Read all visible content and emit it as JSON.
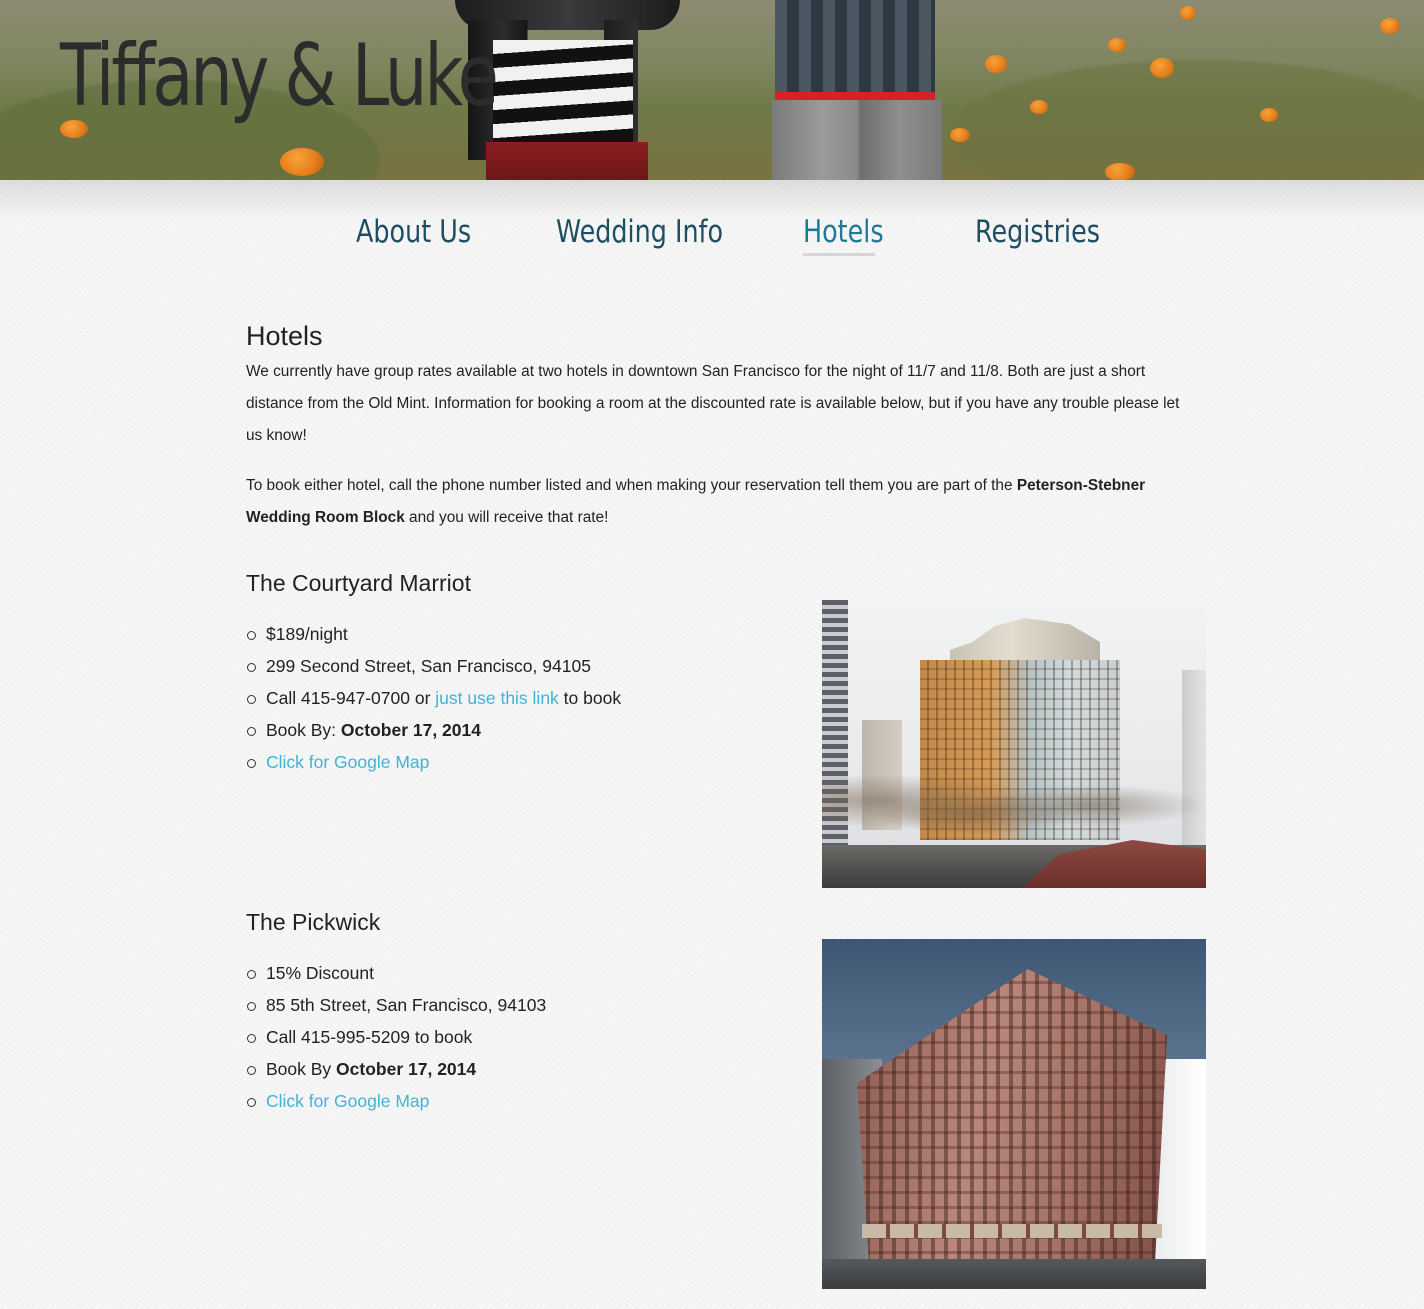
{
  "header": {
    "site_title": "Tiffany & Luke"
  },
  "nav": {
    "items": [
      {
        "label": "About Us"
      },
      {
        "label": "Wedding Info"
      },
      {
        "label": "Hotels"
      },
      {
        "label": "Registries"
      }
    ],
    "active": "Hotels"
  },
  "main": {
    "title": "Hotels",
    "intro": "We currently have group rates available at two hotels in downtown San Francisco for the night of 11/7 and 11/8. Both are just a short distance from the Old Mint. Information for booking a room at the discounted rate is available below, but if you have any trouble please let us know!",
    "booking_prefix": "To book either hotel, call the phone number listed and when making your reservation tell them you are part of the ",
    "booking_bold": "Peterson-Stebner Wedding Room Block",
    "booking_suffix": " and you will receive that rate!"
  },
  "hotels": [
    {
      "name": "The Courtyard Marriot",
      "rate": "$189/night",
      "address": "299 Second Street, San Francisco, 94105",
      "call_prefix": "Call 415-947-0700 or ",
      "call_link": "just use this link",
      "call_suffix": " to book",
      "book_by_label": "Book By: ",
      "book_by_date": "October 17, 2014",
      "map_link": "Click for Google Map"
    },
    {
      "name": "The Pickwick",
      "rate": "15% Discount",
      "address": "85 5th Street, San Francisco, 94103",
      "call_text": "Call 415-995-5209 to book",
      "book_by_label": "Book By ",
      "book_by_date": "October 17, 2014",
      "map_link": "Click for Google Map"
    }
  ],
  "colors": {
    "nav": "#1d4e63",
    "nav_active": "#1f7b95",
    "link": "#3fb4d7",
    "text": "#222222"
  }
}
